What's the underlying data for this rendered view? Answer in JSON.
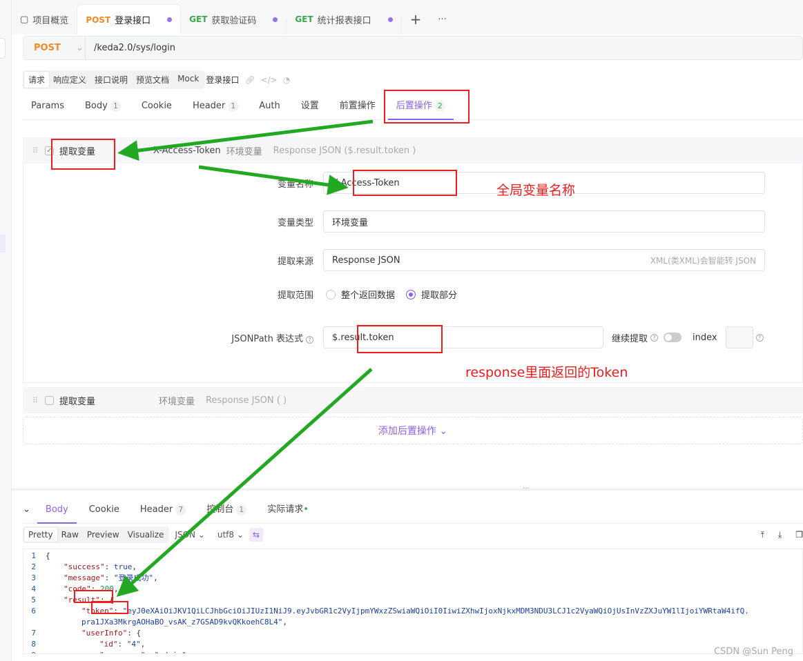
{
  "tabs": [
    {
      "label": "项目概览",
      "icon": "layout-icon"
    },
    {
      "method": "POST",
      "label": "登录接口",
      "active": true
    },
    {
      "method": "GET",
      "label": "获取验证码"
    },
    {
      "method": "GET",
      "label": "统计报表接口"
    }
  ],
  "tab_add": "+",
  "tab_more": "···",
  "url": {
    "method": "POST",
    "path": "/keda2.0/sys/login"
  },
  "subtabs": [
    "请求",
    "响应定义",
    "接口说明",
    "预览文档",
    "Mock"
  ],
  "api_name": "登录接口",
  "req_tabs": [
    {
      "label": "Params"
    },
    {
      "label": "Body",
      "badge": "1"
    },
    {
      "label": "Cookie"
    },
    {
      "label": "Header",
      "badge": "1"
    },
    {
      "label": "Auth"
    },
    {
      "label": "设置"
    },
    {
      "label": "前置操作"
    },
    {
      "label": "后置操作",
      "badge": "2",
      "active": true
    }
  ],
  "post1": {
    "title": "提取变量",
    "var": "X-Access-Token",
    "type": "环境变量",
    "source": "Response JSON ($.result.token )"
  },
  "form": {
    "name_label": "变量名称",
    "name_value": "X-Access-Token",
    "type_label": "变量类型",
    "type_value": "环境变量",
    "source_label": "提取来源",
    "source_value": "Response JSON",
    "source_hint": "XML(类XML)会智能转 JSON",
    "scope_label": "提取范围",
    "scope_all": "整个返回数据",
    "scope_part": "提取部分",
    "jsonpath_label": "JSONPath 表达式",
    "jsonpath_value": "$.result.token",
    "continue_label": "继续提取",
    "index_label": "index"
  },
  "post2": {
    "title": "提取变量",
    "type": "环境变量",
    "source": "Response JSON ( )"
  },
  "add_label": "添加后置操作",
  "resp_tabs": [
    {
      "label": "Body",
      "active": true
    },
    {
      "label": "Cookie"
    },
    {
      "label": "Header",
      "badge": "7"
    },
    {
      "label": "控制台",
      "badge": "1"
    },
    {
      "label": "实际请求"
    }
  ],
  "resp_tools": {
    "modes": [
      "Pretty",
      "Raw",
      "Preview",
      "Visualize"
    ],
    "format": "JSON",
    "encoding": "utf8"
  },
  "code_lines": [
    {
      "n": "1",
      "i": 0,
      "parts": [
        [
          "p",
          "{"
        ]
      ]
    },
    {
      "n": "2",
      "i": 1,
      "parts": [
        [
          "k",
          "\"success\""
        ],
        [
          "p",
          ": "
        ],
        [
          "s",
          "true"
        ],
        [
          "p",
          ","
        ]
      ]
    },
    {
      "n": "3",
      "i": 1,
      "parts": [
        [
          "k",
          "\"message\""
        ],
        [
          "p",
          ": "
        ],
        [
          "s",
          "\"登录成功\""
        ],
        [
          "p",
          ","
        ]
      ]
    },
    {
      "n": "4",
      "i": 1,
      "parts": [
        [
          "k",
          "\"code\""
        ],
        [
          "p",
          ": "
        ],
        [
          "n",
          "200"
        ],
        [
          "p",
          ","
        ]
      ]
    },
    {
      "n": "5",
      "i": 1,
      "parts": [
        [
          "k",
          "\"result\""
        ],
        [
          "p",
          ": {"
        ]
      ]
    },
    {
      "n": "6",
      "i": 2,
      "parts": [
        [
          "k",
          "\"token\""
        ],
        [
          "p",
          ": "
        ],
        [
          "s",
          "\"eyJ0eXAiOiJKV1QiLCJhbGciOiJIUzI1NiJ9.eyJvbGR1c2VyIjpmYWxzZSwiaWQiOiI0IiwiZXhwIjoxNjkxMDM3NDU3LCJ1c2VyaWQiOjUsInVzZXJuYW1lIjoiYWRtaW4ifQ."
        ]
      ]
    },
    {
      "n": "",
      "i": 2,
      "parts": [
        [
          "s",
          "pra1JXa3MkrgAOHaBO_vsAK_z7GSAD9kvQKkoehC8L4\""
        ],
        [
          "p",
          ","
        ]
      ]
    },
    {
      "n": "7",
      "i": 2,
      "parts": [
        [
          "k",
          "\"userInfo\""
        ],
        [
          "p",
          ": {"
        ]
      ]
    },
    {
      "n": "8",
      "i": 3,
      "parts": [
        [
          "k",
          "\"id\""
        ],
        [
          "p",
          ": "
        ],
        [
          "s",
          "\"4\""
        ],
        [
          "p",
          ","
        ]
      ]
    },
    {
      "n": "9",
      "i": 3,
      "parts": [
        [
          "k",
          "\"username\""
        ],
        [
          "p",
          ": "
        ],
        [
          "s",
          "\"admin\""
        ],
        [
          "p",
          ","
        ]
      ]
    }
  ],
  "annotations": {
    "global_var": "全局变量名称",
    "token_note": "response里面返回的Token",
    "color_box": "#ee1c1c",
    "color_arrow": "#22a822"
  },
  "watermark": "CSDN @Sun  Peng",
  "colors": {
    "accent": "#8a62e8",
    "post": "#f08a24",
    "get": "#3aa84a"
  }
}
